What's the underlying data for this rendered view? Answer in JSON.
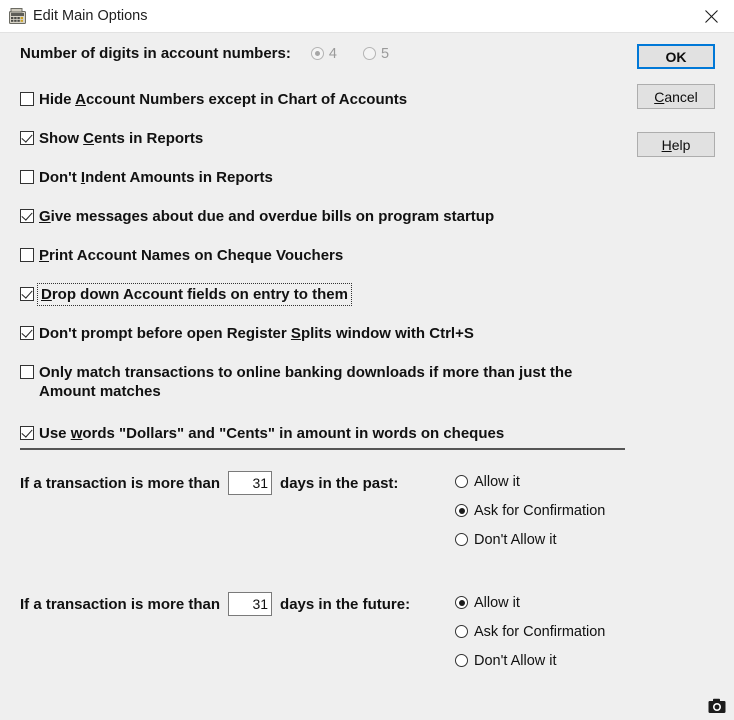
{
  "window": {
    "title": "Edit Main Options",
    "icon": "calculator-icon",
    "close_label": "close-icon"
  },
  "digits": {
    "label": "Number of digits in account numbers:",
    "options": [
      {
        "label": "4",
        "selected": true
      },
      {
        "label": "5",
        "selected": false
      }
    ],
    "disabled": true
  },
  "buttons": {
    "ok": {
      "label": "OK",
      "focused": true
    },
    "cancel": {
      "label": "Cancel",
      "accel": "C"
    },
    "help": {
      "label": "Help",
      "accel": "H"
    }
  },
  "checkboxes": [
    {
      "pre": "Hide ",
      "accel": "A",
      "post": "ccount Numbers except in Chart of Accounts",
      "checked": false,
      "focused": false
    },
    {
      "pre": "Show ",
      "accel": "C",
      "post": "ents in Reports",
      "checked": true,
      "focused": false
    },
    {
      "pre": "Don't ",
      "accel": "I",
      "post": "ndent Amounts in Reports",
      "checked": false,
      "focused": false
    },
    {
      "pre": "",
      "accel": "G",
      "post": "ive messages about due and overdue bills on program startup",
      "checked": true,
      "focused": false
    },
    {
      "pre": "",
      "accel": "P",
      "post": "rint Account Names on Cheque Vouchers",
      "checked": false,
      "focused": false
    },
    {
      "pre": "",
      "accel": "D",
      "post": "rop down Account fields on entry to them",
      "checked": true,
      "focused": true
    },
    {
      "pre": "Don't prompt before open Register ",
      "accel": "S",
      "post": "plits window with Ctrl+S",
      "checked": true,
      "focused": false
    },
    {
      "pre": "Only match transactions to online banking downloads if more than just the Amount matches",
      "accel": "",
      "post": "",
      "checked": false,
      "focused": false
    },
    {
      "pre": "Use ",
      "accel": "w",
      "post": "ords \"Dollars\" and \"Cents\" in amount in words on cheques",
      "checked": true,
      "focused": false
    }
  ],
  "past_rule": {
    "text_before": "If a transaction is more than",
    "days": "31",
    "text_after": "days in the past:",
    "options": [
      {
        "label": "Allow it",
        "selected": false
      },
      {
        "label": "Ask for Confirmation",
        "selected": true
      },
      {
        "label": "Don't Allow it",
        "selected": false
      }
    ]
  },
  "future_rule": {
    "text_before": "If a transaction is more than",
    "days": "31",
    "text_after": "days in the future:",
    "options": [
      {
        "label": "Allow it",
        "selected": true
      },
      {
        "label": "Ask for Confirmation",
        "selected": false
      },
      {
        "label": "Don't Allow it",
        "selected": false
      }
    ]
  },
  "overlay": {
    "camera_icon": "camera-icon",
    "background_ghost_text": ""
  },
  "colors": {
    "dialog_bg": "#efefef",
    "titlebar_bg": "#ffffff",
    "focus_blue": "#0078d7",
    "button_face": "#e1e1e1",
    "text": "#111111",
    "disabled_text": "#9a9a9a",
    "separator": "#555555"
  }
}
